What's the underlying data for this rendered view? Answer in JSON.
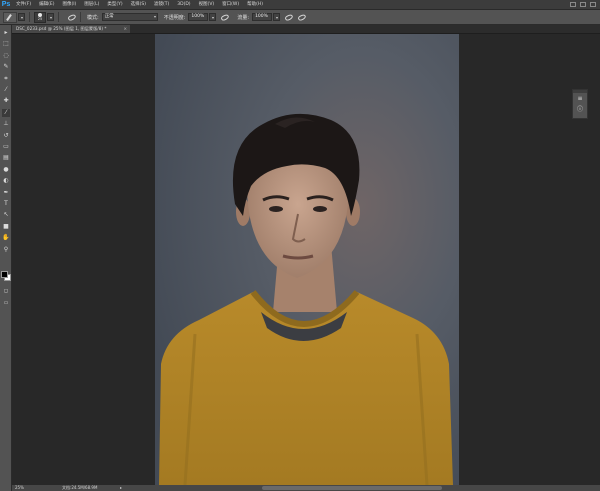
{
  "app": {
    "logo": "Ps"
  },
  "menubar": {
    "items": [
      "文件(F)",
      "编辑(E)",
      "图像(I)",
      "图层(L)",
      "类型(Y)",
      "选择(S)",
      "滤镜(T)",
      "3D(D)",
      "视图(V)",
      "窗口(W)",
      "帮助(H)"
    ]
  },
  "options": {
    "brush_size": "25",
    "mode_label": "模式:",
    "mode_value": "正常",
    "opacity_label": "不透明度:",
    "opacity_value": "100%",
    "flow_label": "流量:",
    "flow_value": "100%"
  },
  "document": {
    "tab_title": "DSC_0233.psd @ 25% (图层 1, 图层蒙版/8) *",
    "close_glyph": "×"
  },
  "statusbar": {
    "zoom": "25%",
    "doc_info": "文档:24.5M/68.9M"
  },
  "colors": {
    "foreground": "#000000",
    "background": "#ffffff",
    "accent": "#31a8ff"
  },
  "tools": [
    {
      "name": "move-tool-icon",
      "glyph": "▸"
    },
    {
      "name": "marquee-tool-icon",
      "glyph": "⬚"
    },
    {
      "name": "lasso-tool-icon",
      "glyph": "◌"
    },
    {
      "name": "quick-select-tool-icon",
      "glyph": "✎"
    },
    {
      "name": "crop-tool-icon",
      "glyph": "⌗"
    },
    {
      "name": "eyedropper-tool-icon",
      "glyph": "⁄"
    },
    {
      "name": "healing-brush-tool-icon",
      "glyph": "✚"
    },
    {
      "name": "brush-tool-icon",
      "glyph": "⁄"
    },
    {
      "name": "clone-stamp-tool-icon",
      "glyph": "⊥"
    },
    {
      "name": "history-brush-tool-icon",
      "glyph": "↺"
    },
    {
      "name": "eraser-tool-icon",
      "glyph": "▭"
    },
    {
      "name": "gradient-tool-icon",
      "glyph": "▤"
    },
    {
      "name": "blur-tool-icon",
      "glyph": "●"
    },
    {
      "name": "dodge-tool-icon",
      "glyph": "◐"
    },
    {
      "name": "pen-tool-icon",
      "glyph": "✒"
    },
    {
      "name": "type-tool-icon",
      "glyph": "T"
    },
    {
      "name": "path-select-tool-icon",
      "glyph": "↖"
    },
    {
      "name": "shape-tool-icon",
      "glyph": "■"
    },
    {
      "name": "hand-tool-icon",
      "glyph": "✋"
    },
    {
      "name": "zoom-tool-icon",
      "glyph": "⚲"
    }
  ],
  "right_panel": [
    {
      "name": "brush-settings-icon",
      "glyph": "≡"
    },
    {
      "name": "info-icon",
      "glyph": "ⓘ"
    }
  ]
}
